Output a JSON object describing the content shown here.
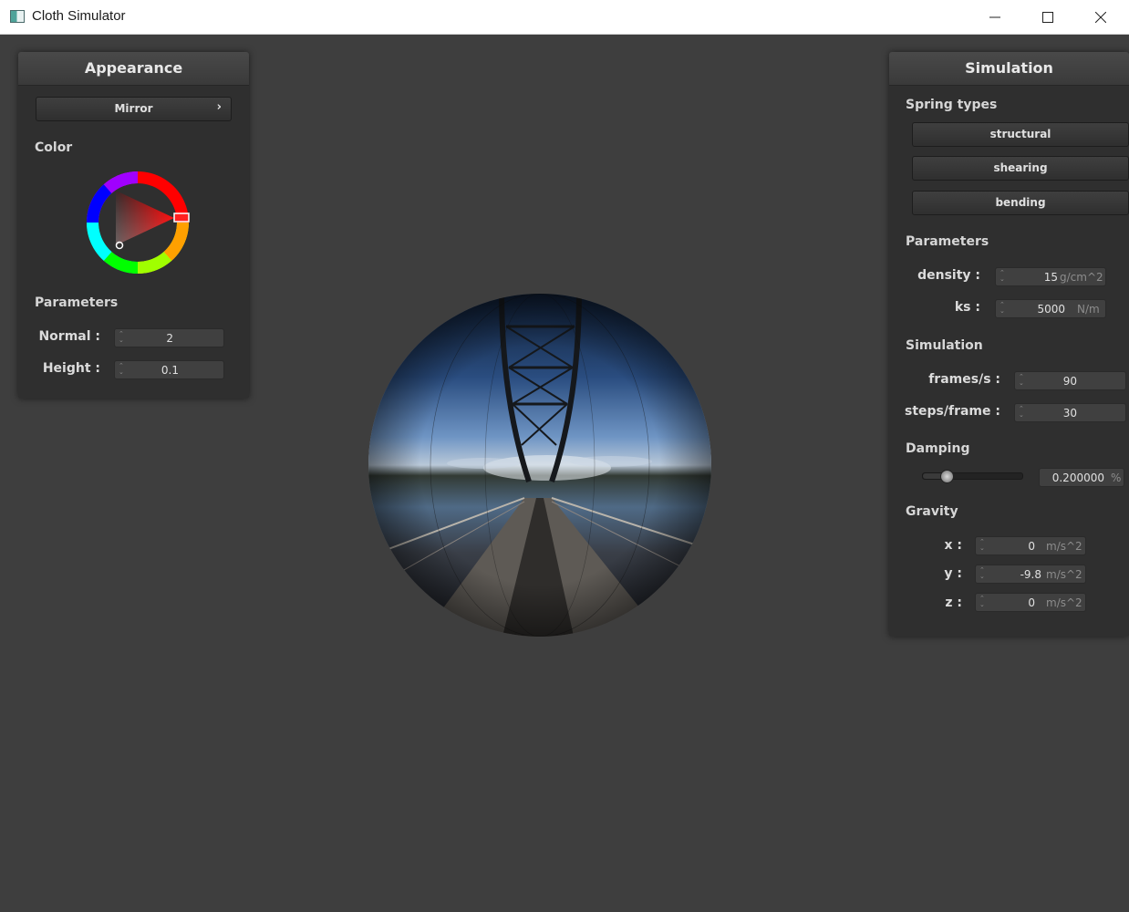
{
  "window": {
    "title": "Cloth Simulator"
  },
  "appearance": {
    "header": "Appearance",
    "shader_dropdown": {
      "value": "Mirror",
      "chevron": "›"
    },
    "color_label": "Color",
    "color_wheel": {
      "selected_hue": "#ff0000"
    },
    "parameters_label": "Parameters",
    "normal": {
      "label": "Normal :",
      "value": "2"
    },
    "height": {
      "label": "Height :",
      "value": "0.1"
    }
  },
  "simulation": {
    "header": "Simulation",
    "spring_types_label": "Spring types",
    "springs": [
      "structural",
      "shearing",
      "bending"
    ],
    "parameters_label": "Parameters",
    "density": {
      "label": "density :",
      "value": "15",
      "unit": "g/cm^2"
    },
    "ks": {
      "label": "ks :",
      "value": "5000",
      "unit": "N/m"
    },
    "simulation_label": "Simulation",
    "frames": {
      "label": "frames/s :",
      "value": "90"
    },
    "steps": {
      "label": "steps/frame :",
      "value": "30"
    },
    "damping_label": "Damping",
    "damping": {
      "value": "0.200000",
      "unit": "%",
      "fraction": 0.2
    },
    "gravity_label": "Gravity",
    "gx": {
      "label": "x :",
      "value": "0",
      "unit": "m/s^2"
    },
    "gy": {
      "label": "y :",
      "value": "-9.8",
      "unit": "m/s^2"
    },
    "gz": {
      "label": "z :",
      "value": "0",
      "unit": "m/s^2"
    }
  },
  "viewport": {
    "object": "mirror-sphere-environment-map"
  }
}
